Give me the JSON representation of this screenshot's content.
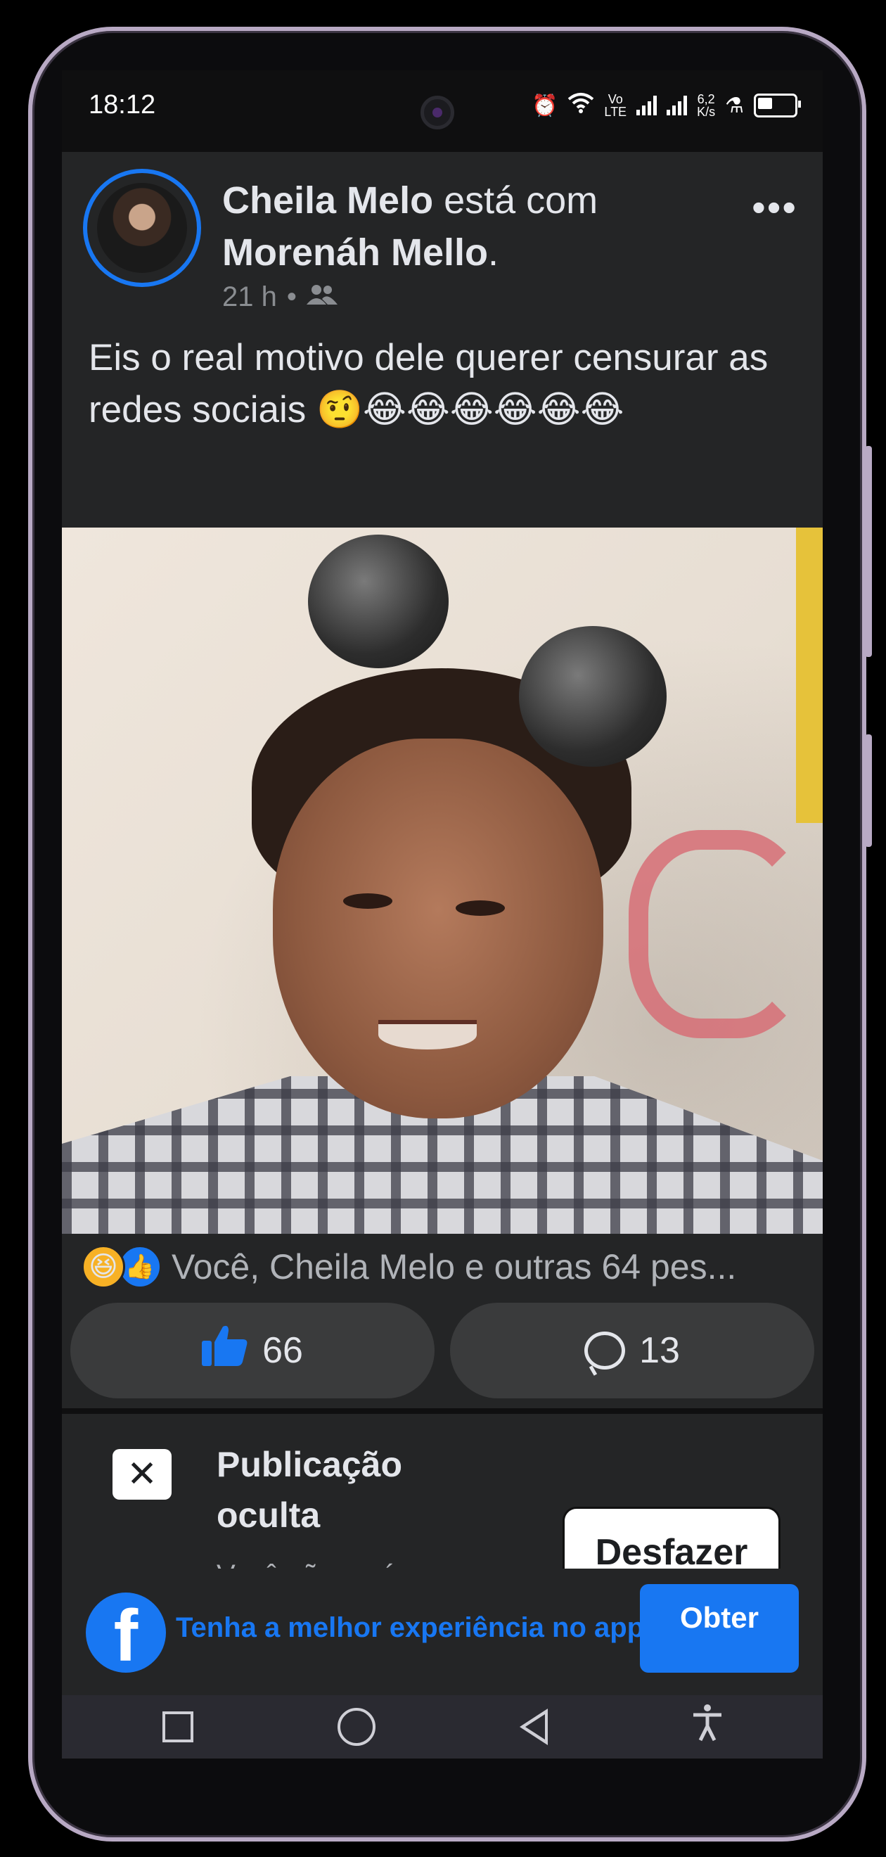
{
  "status_bar": {
    "time": "18:12",
    "network_top": "Vo",
    "network_bottom": "LTE",
    "speed_top": "6,2",
    "speed_bottom": "K/s"
  },
  "post": {
    "author": "Cheila Melo",
    "with_text": "está com",
    "tagged": "Morenáh Mello",
    "tagged_suffix": ".",
    "time_ago": "21 h",
    "separator": "•",
    "audience_icon": "friends-icon",
    "more_icon": "more-dots-icon",
    "more_label": "•••",
    "text": "Eis o real motivo dele querer censurar as redes sociais 🤨😂😂😂😂😂😂"
  },
  "reactions": {
    "haha_icon": "😆",
    "like_icon": "👍",
    "summary": "Você, Cheila Melo e outras 64 pes..."
  },
  "actions": {
    "like_count": "66",
    "comment_count": "13"
  },
  "hidden_post": {
    "close_label": "✕",
    "title": "Publicação oculta",
    "description": "Você não verá essa publicação no seu",
    "undo_label": "Desfazer"
  },
  "app_banner": {
    "logo_letter": "f",
    "text": "Tenha a melhor experiência no app",
    "button_label": "Obter"
  },
  "colors": {
    "accent": "#1877f2",
    "surface": "#242526",
    "button_bg": "#3a3b3c"
  }
}
